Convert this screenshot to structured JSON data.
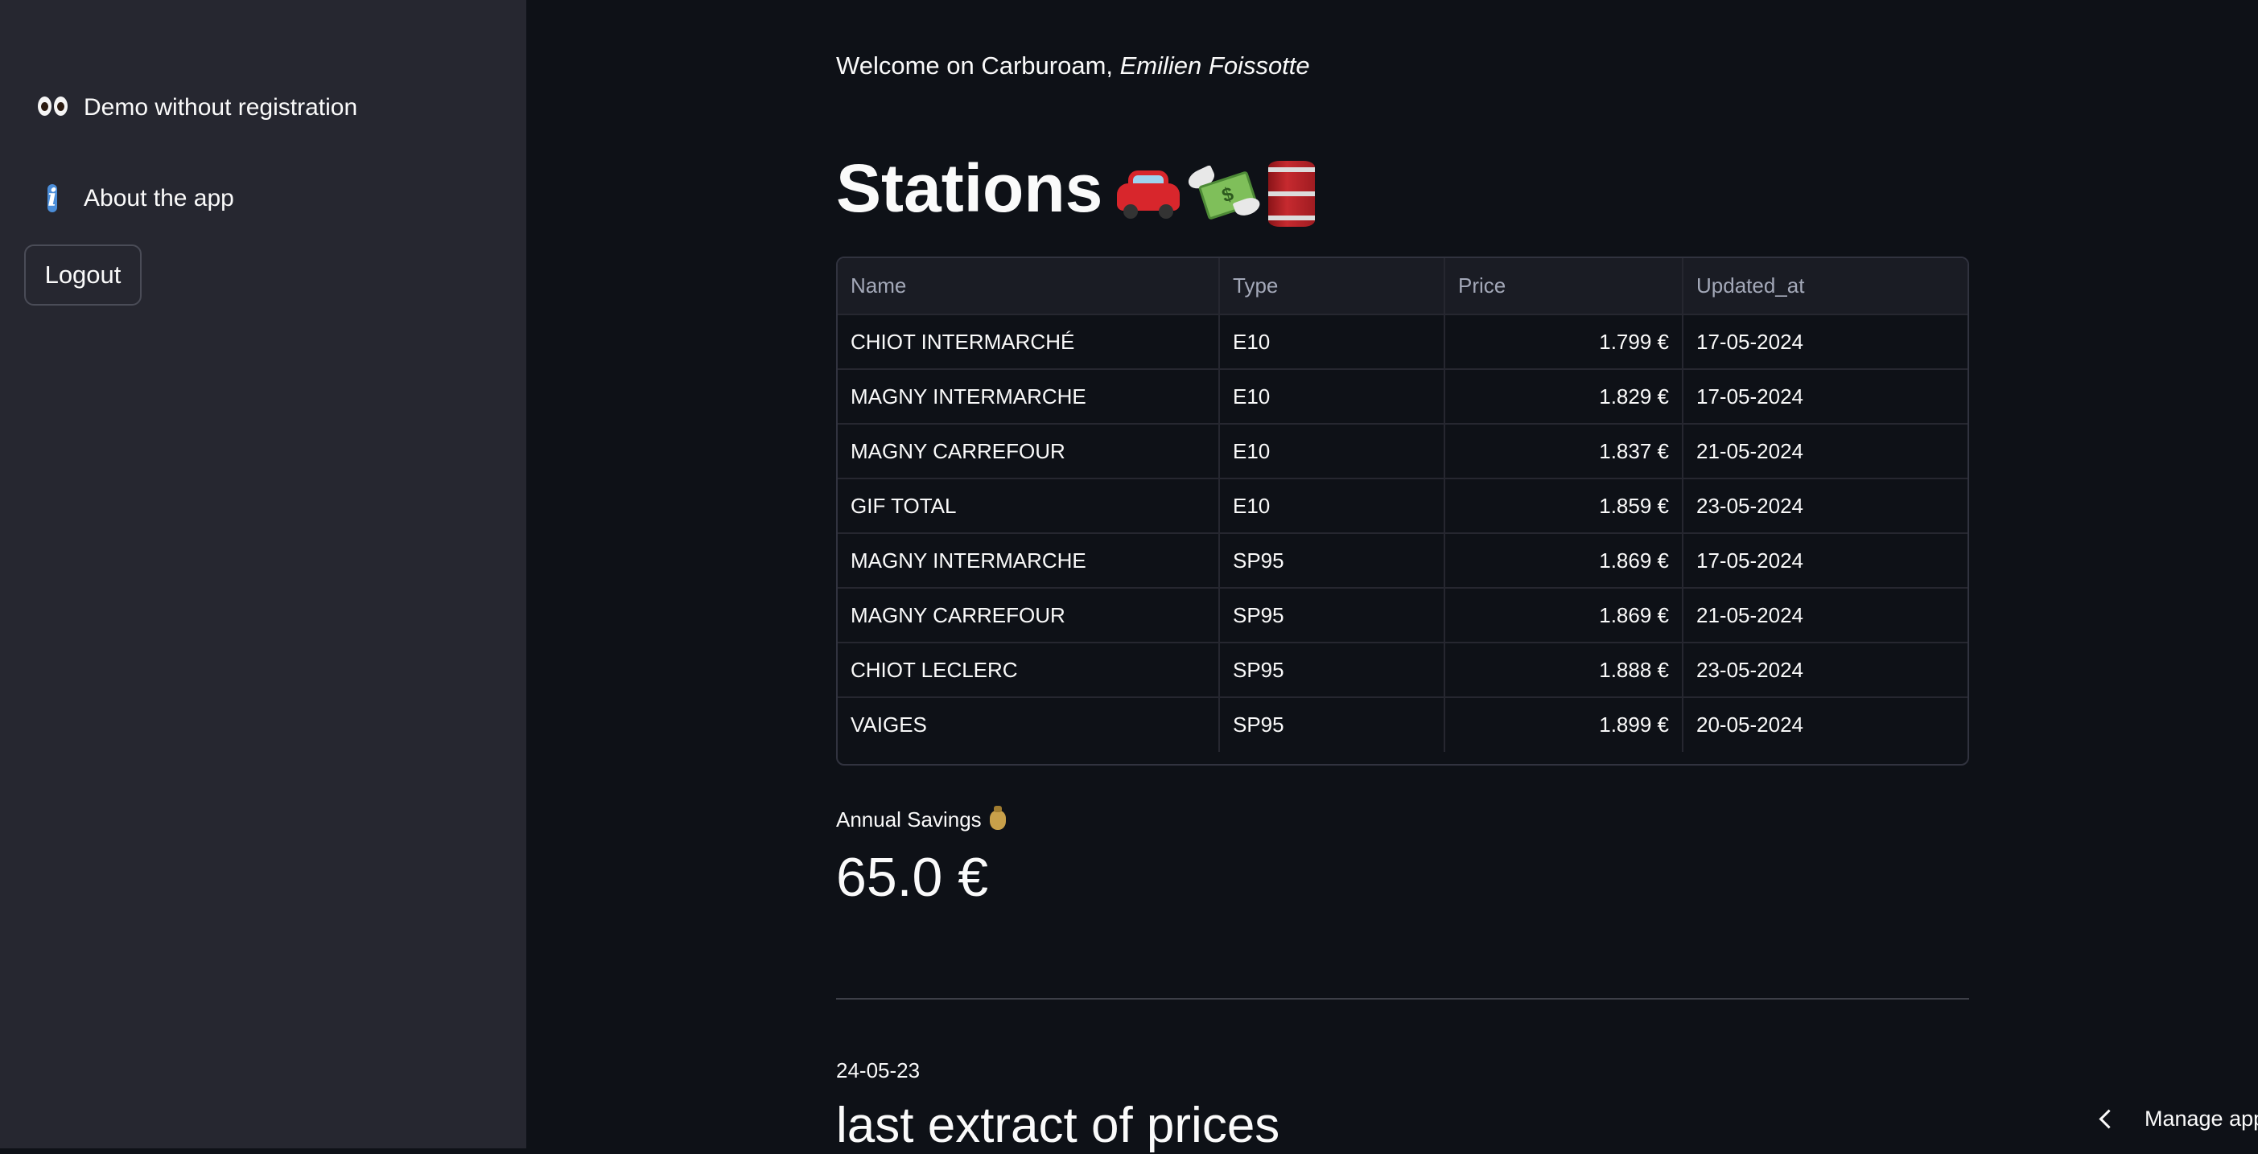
{
  "sidebar": {
    "items": [
      {
        "icon": "eyes-icon",
        "label": "Demo without registration"
      },
      {
        "icon": "info-icon",
        "label": "About the app"
      }
    ],
    "logout_label": "Logout"
  },
  "main": {
    "welcome_prefix": "Welcome on Carburoam, ",
    "user_name": "Emilien Foissotte",
    "title": "Stations",
    "title_icons": [
      "car-icon",
      "money-with-wings-icon",
      "oil-barrel-icon"
    ],
    "table": {
      "columns": [
        "Name",
        "Type",
        "Price",
        "Updated_at"
      ],
      "rows": [
        [
          "CHIOT INTERMARCHÉ",
          "E10",
          "1.799 €",
          "17-05-2024"
        ],
        [
          "MAGNY INTERMARCHE",
          "E10",
          "1.829 €",
          "17-05-2024"
        ],
        [
          "MAGNY CARREFOUR",
          "E10",
          "1.837 €",
          "21-05-2024"
        ],
        [
          "GIF TOTAL",
          "E10",
          "1.859 €",
          "23-05-2024"
        ],
        [
          "MAGNY INTERMARCHE",
          "SP95",
          "1.869 €",
          "17-05-2024"
        ],
        [
          "MAGNY CARREFOUR",
          "SP95",
          "1.869 €",
          "21-05-2024"
        ],
        [
          "CHIOT LECLERC",
          "SP95",
          "1.888 €",
          "23-05-2024"
        ],
        [
          "VAIGES",
          "SP95",
          "1.899 €",
          "20-05-2024"
        ]
      ]
    },
    "metric": {
      "label": "Annual Savings",
      "icon": "money-bag-icon",
      "value": "65.0 €"
    },
    "date": "24-05-23",
    "subtitle": "last extract of prices"
  },
  "footer": {
    "manage_label": "Manage app"
  },
  "colors": {
    "background": "#0e1117",
    "sidebar": "#262730",
    "text": "#fafafa"
  }
}
